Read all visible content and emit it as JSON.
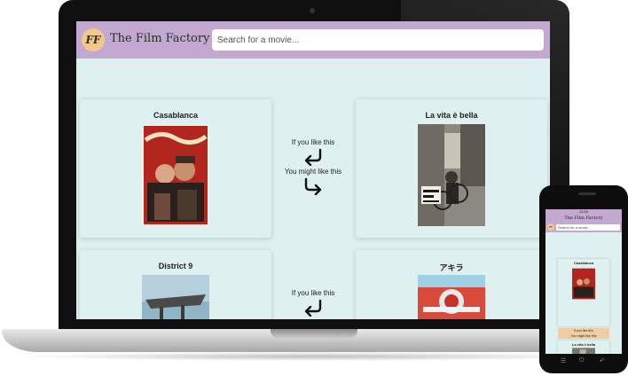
{
  "app": {
    "brand_initials": "FF",
    "title": "The Film Factory"
  },
  "search": {
    "placeholder": "Search for a movie..."
  },
  "middle": {
    "if_you_like": "If you like this",
    "you_might_like": "You might like this"
  },
  "rows": [
    {
      "left_title": "Casablanca",
      "right_title": "La vita è bella"
    },
    {
      "left_title": "District 9",
      "right_title": "アキラ"
    }
  ],
  "mobile": {
    "status_time": "12:30",
    "title": "The Film Factory",
    "search_placeholder": "Search for a movie...",
    "card_title": "Casablanca",
    "if_you_like": "If you like this",
    "you_might_like": "You might like this",
    "next_title": "La vita è bella"
  },
  "colors": {
    "header": "#c3a8d1",
    "background": "#def0f0",
    "logo": "#f3c98b"
  }
}
